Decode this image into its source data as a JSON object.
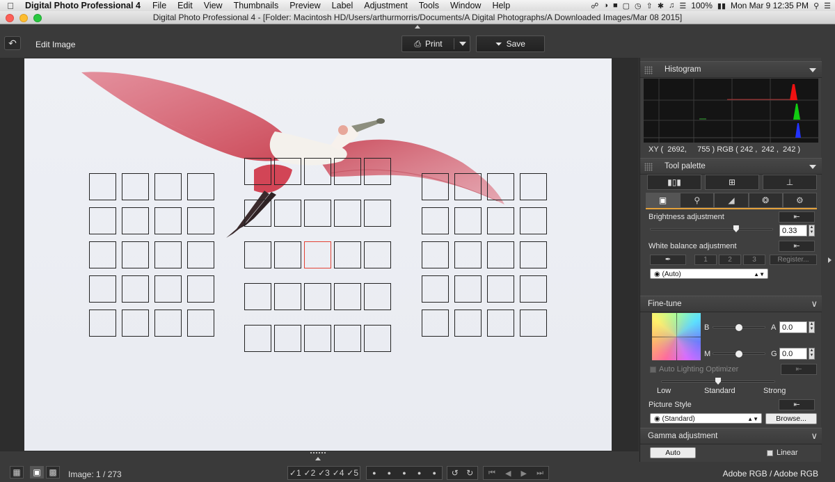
{
  "menubar": {
    "app_name": "Digital Photo Professional 4",
    "items": [
      "File",
      "Edit",
      "View",
      "Thumbnails",
      "Preview",
      "Label",
      "Adjustment",
      "Tools",
      "Window",
      "Help"
    ],
    "battery": "100%",
    "clock": "Mon Mar 9  12:35 PM"
  },
  "window": {
    "title": "Digital Photo Professional 4 - [Folder: Macintosh HD/Users/arthurmorris/Documents/A Digital Photographs/A Downloaded Images/Mar 08 2015]"
  },
  "toolbar": {
    "mode_label": "Edit Image",
    "print_label": "Print",
    "save_label": "Save"
  },
  "histogram": {
    "title": "Histogram",
    "xy_readout": "XY (  2692,     755 ) RGB ( 242 ,  242 ,  242 )"
  },
  "tool_palette": {
    "title": "Tool palette",
    "brightness": {
      "label": "Brightness adjustment",
      "value": "0.33",
      "slider_fraction": 0.7
    },
    "white_balance": {
      "label": "White balance adjustment",
      "presets": [
        "1",
        "2",
        "3"
      ],
      "register_label": "Register...",
      "mode": "(Auto)"
    }
  },
  "fine_tune": {
    "title": "Fine-tune",
    "ba": {
      "left": "B",
      "right": "A",
      "value": "0.0",
      "slider_fraction": 0.5
    },
    "mg": {
      "left": "M",
      "right": "G",
      "value": "0.0",
      "slider_fraction": 0.5
    },
    "alo": {
      "label": "Auto Lighting Optimizer",
      "levels": [
        "Low",
        "Standard",
        "Strong"
      ],
      "level_fraction": 0.5
    },
    "picture_style": {
      "label": "Picture Style",
      "value": "(Standard)",
      "browse_label": "Browse..."
    }
  },
  "gamma": {
    "title": "Gamma adjustment",
    "auto_label": "Auto",
    "linear_label": "Linear"
  },
  "statusbar": {
    "image_count": "Image: 1 / 273",
    "ratings": [
      "1",
      "2",
      "3",
      "4",
      "5"
    ],
    "color_space": "Adobe RGB / Adobe RGB"
  },
  "colors": {
    "af_active": "#e24234",
    "accent_tab": "#e5a23b"
  }
}
